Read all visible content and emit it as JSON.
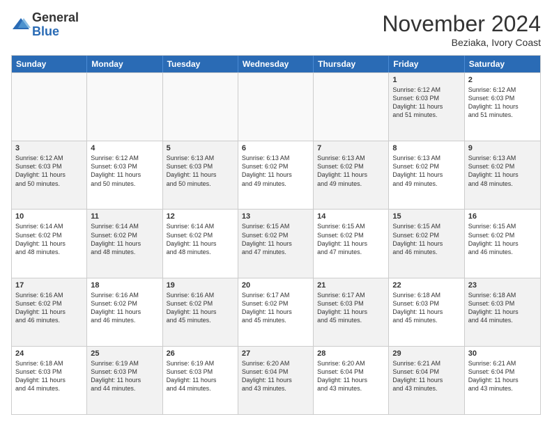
{
  "logo": {
    "general": "General",
    "blue": "Blue"
  },
  "title": "November 2024",
  "location": "Beziaka, Ivory Coast",
  "header_days": [
    "Sunday",
    "Monday",
    "Tuesday",
    "Wednesday",
    "Thursday",
    "Friday",
    "Saturday"
  ],
  "weeks": [
    [
      {
        "day": "",
        "text": "",
        "empty": true
      },
      {
        "day": "",
        "text": "",
        "empty": true
      },
      {
        "day": "",
        "text": "",
        "empty": true
      },
      {
        "day": "",
        "text": "",
        "empty": true
      },
      {
        "day": "",
        "text": "",
        "empty": true
      },
      {
        "day": "1",
        "text": "Sunrise: 6:12 AM\nSunset: 6:03 PM\nDaylight: 11 hours\nand 51 minutes.",
        "empty": false
      },
      {
        "day": "2",
        "text": "Sunrise: 6:12 AM\nSunset: 6:03 PM\nDaylight: 11 hours\nand 51 minutes.",
        "empty": false
      }
    ],
    [
      {
        "day": "3",
        "text": "Sunrise: 6:12 AM\nSunset: 6:03 PM\nDaylight: 11 hours\nand 50 minutes.",
        "empty": false
      },
      {
        "day": "4",
        "text": "Sunrise: 6:12 AM\nSunset: 6:03 PM\nDaylight: 11 hours\nand 50 minutes.",
        "empty": false
      },
      {
        "day": "5",
        "text": "Sunrise: 6:13 AM\nSunset: 6:03 PM\nDaylight: 11 hours\nand 50 minutes.",
        "empty": false
      },
      {
        "day": "6",
        "text": "Sunrise: 6:13 AM\nSunset: 6:02 PM\nDaylight: 11 hours\nand 49 minutes.",
        "empty": false
      },
      {
        "day": "7",
        "text": "Sunrise: 6:13 AM\nSunset: 6:02 PM\nDaylight: 11 hours\nand 49 minutes.",
        "empty": false
      },
      {
        "day": "8",
        "text": "Sunrise: 6:13 AM\nSunset: 6:02 PM\nDaylight: 11 hours\nand 49 minutes.",
        "empty": false
      },
      {
        "day": "9",
        "text": "Sunrise: 6:13 AM\nSunset: 6:02 PM\nDaylight: 11 hours\nand 48 minutes.",
        "empty": false
      }
    ],
    [
      {
        "day": "10",
        "text": "Sunrise: 6:14 AM\nSunset: 6:02 PM\nDaylight: 11 hours\nand 48 minutes.",
        "empty": false
      },
      {
        "day": "11",
        "text": "Sunrise: 6:14 AM\nSunset: 6:02 PM\nDaylight: 11 hours\nand 48 minutes.",
        "empty": false
      },
      {
        "day": "12",
        "text": "Sunrise: 6:14 AM\nSunset: 6:02 PM\nDaylight: 11 hours\nand 48 minutes.",
        "empty": false
      },
      {
        "day": "13",
        "text": "Sunrise: 6:15 AM\nSunset: 6:02 PM\nDaylight: 11 hours\nand 47 minutes.",
        "empty": false
      },
      {
        "day": "14",
        "text": "Sunrise: 6:15 AM\nSunset: 6:02 PM\nDaylight: 11 hours\nand 47 minutes.",
        "empty": false
      },
      {
        "day": "15",
        "text": "Sunrise: 6:15 AM\nSunset: 6:02 PM\nDaylight: 11 hours\nand 46 minutes.",
        "empty": false
      },
      {
        "day": "16",
        "text": "Sunrise: 6:15 AM\nSunset: 6:02 PM\nDaylight: 11 hours\nand 46 minutes.",
        "empty": false
      }
    ],
    [
      {
        "day": "17",
        "text": "Sunrise: 6:16 AM\nSunset: 6:02 PM\nDaylight: 11 hours\nand 46 minutes.",
        "empty": false
      },
      {
        "day": "18",
        "text": "Sunrise: 6:16 AM\nSunset: 6:02 PM\nDaylight: 11 hours\nand 46 minutes.",
        "empty": false
      },
      {
        "day": "19",
        "text": "Sunrise: 6:16 AM\nSunset: 6:02 PM\nDaylight: 11 hours\nand 45 minutes.",
        "empty": false
      },
      {
        "day": "20",
        "text": "Sunrise: 6:17 AM\nSunset: 6:02 PM\nDaylight: 11 hours\nand 45 minutes.",
        "empty": false
      },
      {
        "day": "21",
        "text": "Sunrise: 6:17 AM\nSunset: 6:03 PM\nDaylight: 11 hours\nand 45 minutes.",
        "empty": false
      },
      {
        "day": "22",
        "text": "Sunrise: 6:18 AM\nSunset: 6:03 PM\nDaylight: 11 hours\nand 45 minutes.",
        "empty": false
      },
      {
        "day": "23",
        "text": "Sunrise: 6:18 AM\nSunset: 6:03 PM\nDaylight: 11 hours\nand 44 minutes.",
        "empty": false
      }
    ],
    [
      {
        "day": "24",
        "text": "Sunrise: 6:18 AM\nSunset: 6:03 PM\nDaylight: 11 hours\nand 44 minutes.",
        "empty": false
      },
      {
        "day": "25",
        "text": "Sunrise: 6:19 AM\nSunset: 6:03 PM\nDaylight: 11 hours\nand 44 minutes.",
        "empty": false
      },
      {
        "day": "26",
        "text": "Sunrise: 6:19 AM\nSunset: 6:03 PM\nDaylight: 11 hours\nand 44 minutes.",
        "empty": false
      },
      {
        "day": "27",
        "text": "Sunrise: 6:20 AM\nSunset: 6:04 PM\nDaylight: 11 hours\nand 43 minutes.",
        "empty": false
      },
      {
        "day": "28",
        "text": "Sunrise: 6:20 AM\nSunset: 6:04 PM\nDaylight: 11 hours\nand 43 minutes.",
        "empty": false
      },
      {
        "day": "29",
        "text": "Sunrise: 6:21 AM\nSunset: 6:04 PM\nDaylight: 11 hours\nand 43 minutes.",
        "empty": false
      },
      {
        "day": "30",
        "text": "Sunrise: 6:21 AM\nSunset: 6:04 PM\nDaylight: 11 hours\nand 43 minutes.",
        "empty": false
      }
    ]
  ]
}
